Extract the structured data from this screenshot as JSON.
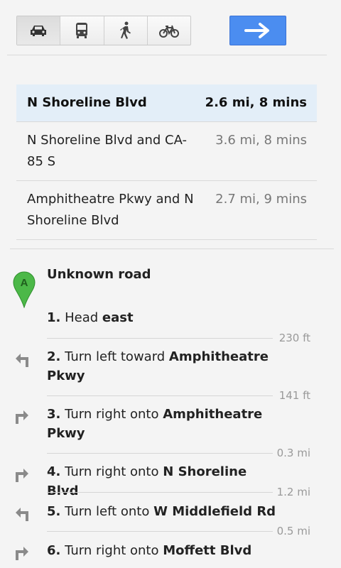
{
  "modes": {
    "items": [
      {
        "icon": "car-icon",
        "selected": true
      },
      {
        "icon": "bus-icon",
        "selected": false
      },
      {
        "icon": "walk-icon",
        "selected": false
      },
      {
        "icon": "bike-icon",
        "selected": false
      }
    ],
    "go_icon": "arrow-right-icon",
    "accent": "#4b8df0"
  },
  "routes": [
    {
      "name": "N Shoreline Blvd",
      "distance": "2.6 mi, 8 mins",
      "selected": true
    },
    {
      "name": "N Shoreline Blvd and CA-85 S",
      "distance": "3.6 mi, 8 mins",
      "selected": false
    },
    {
      "name": "Amphitheatre Pkwy and N Shoreline Blvd",
      "distance": "2.7 mi, 9 mins",
      "selected": false
    }
  ],
  "start": {
    "marker": "A",
    "label": "Unknown road",
    "marker_color": "#4cb848"
  },
  "steps": [
    {
      "num": "1.",
      "text": "Head ",
      "bold": "east",
      "icon": "",
      "distance": "230 ft"
    },
    {
      "num": "2.",
      "text": "Turn left toward ",
      "bold": "Amphitheatre Pkwy",
      "icon": "turn-left-icon",
      "distance": "141 ft"
    },
    {
      "num": "3.",
      "text": "Turn right onto ",
      "bold": "Amphitheatre Pkwy",
      "icon": "turn-right-icon",
      "distance": "0.3 mi"
    },
    {
      "num": "4.",
      "text": "Turn right onto ",
      "bold": "N Shoreline Blvd",
      "icon": "turn-right-icon",
      "distance": "1.2 mi"
    },
    {
      "num": "5.",
      "text": "Turn left onto ",
      "bold": "W Middlefield Rd",
      "icon": "turn-left-icon",
      "distance": "0.5 mi"
    },
    {
      "num": "6.",
      "text": "Turn right onto ",
      "bold": "Moffett Blvd",
      "icon": "turn-right-icon",
      "distance": ""
    }
  ]
}
